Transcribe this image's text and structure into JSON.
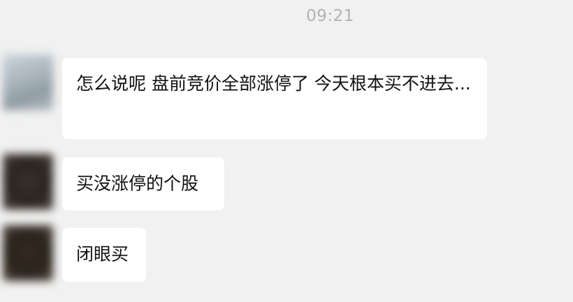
{
  "chat": {
    "timestamp": "09:21",
    "messages": [
      {
        "avatar": "blurred-avatar",
        "text": "怎么说呢 盘前竞价全部涨停了 今天根本买不进去..."
      },
      {
        "avatar": "blurred-avatar",
        "text": "买没涨停的个股"
      },
      {
        "avatar": "blurred-avatar",
        "text": "闭眼买"
      }
    ]
  },
  "colors": {
    "background": "#f1f1f1",
    "bubble": "#ffffff",
    "timestamp": "#b2b2b2",
    "text": "#111111"
  }
}
